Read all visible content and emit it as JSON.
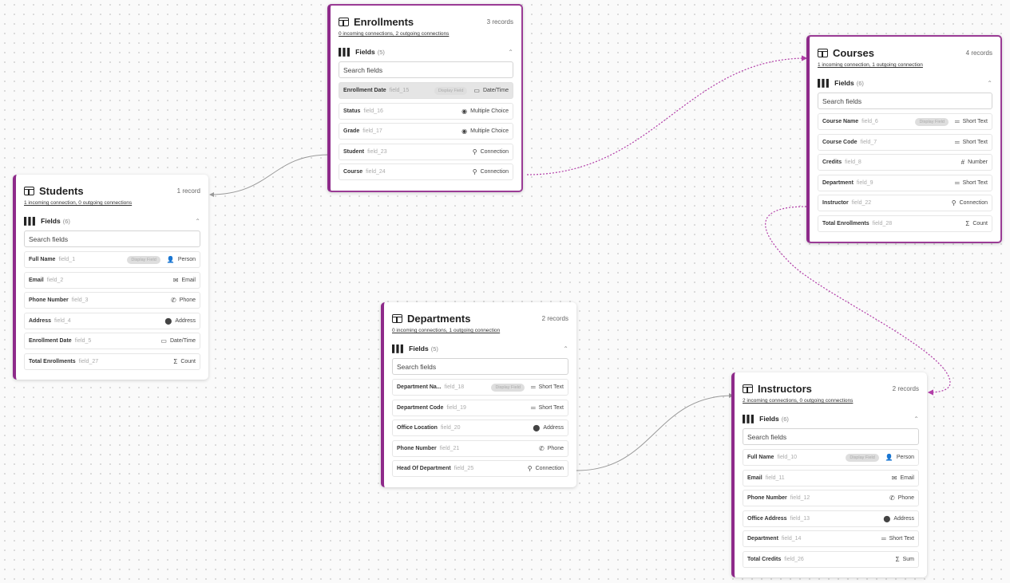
{
  "canvas": {
    "edge_color": "#999999",
    "highlight_edge_color": "#b23ea8",
    "accent": "#8e2a8a"
  },
  "tables": {
    "enrollments": {
      "title": "Enrollments",
      "records": "3 records",
      "connections": "0 incoming connections, 2 outgoing connections",
      "fields_label": "Fields",
      "fields_count": "(5)",
      "search_placeholder": "Search fields",
      "fields": [
        {
          "name": "Enrollment Date",
          "id": "field_15",
          "display": "Display Field",
          "type": "Date/Time",
          "icon": "calendar-icon"
        },
        {
          "name": "Status",
          "id": "field_16",
          "type": "Multiple Choice",
          "icon": "choice-icon"
        },
        {
          "name": "Grade",
          "id": "field_17",
          "type": "Multiple Choice",
          "icon": "choice-icon"
        },
        {
          "name": "Student",
          "id": "field_23",
          "type": "Connection",
          "icon": "connection-icon"
        },
        {
          "name": "Course",
          "id": "field_24",
          "type": "Connection",
          "icon": "connection-icon"
        }
      ]
    },
    "courses": {
      "title": "Courses",
      "records": "4 records",
      "connections": "1 incoming connection, 1 outgoing connection",
      "fields_label": "Fields",
      "fields_count": "(6)",
      "search_placeholder": "Search fields",
      "fields": [
        {
          "name": "Course Name",
          "id": "field_6",
          "display": "Display Field",
          "type": "Short Text",
          "icon": "text-icon"
        },
        {
          "name": "Course Code",
          "id": "field_7",
          "type": "Short Text",
          "icon": "text-icon"
        },
        {
          "name": "Credits",
          "id": "field_8",
          "type": "Number",
          "icon": "number-icon"
        },
        {
          "name": "Department",
          "id": "field_9",
          "type": "Short Text",
          "icon": "text-icon"
        },
        {
          "name": "Instructor",
          "id": "field_22",
          "type": "Connection",
          "icon": "connection-icon"
        },
        {
          "name": "Total Enrollments",
          "id": "field_28",
          "type": "Count",
          "icon": "sigma-icon"
        }
      ]
    },
    "students": {
      "title": "Students",
      "records": "1 record",
      "connections": "1 incoming connection, 0 outgoing connections",
      "fields_label": "Fields",
      "fields_count": "(6)",
      "search_placeholder": "Search fields",
      "fields": [
        {
          "name": "Full Name",
          "id": "field_1",
          "display": "Display Field",
          "type": "Person",
          "icon": "person-icon"
        },
        {
          "name": "Email",
          "id": "field_2",
          "type": "Email",
          "icon": "email-icon"
        },
        {
          "name": "Phone Number",
          "id": "field_3",
          "type": "Phone",
          "icon": "phone-icon"
        },
        {
          "name": "Address",
          "id": "field_4",
          "type": "Address",
          "icon": "pin-icon"
        },
        {
          "name": "Enrollment Date",
          "id": "field_5",
          "type": "Date/Time",
          "icon": "calendar-icon"
        },
        {
          "name": "Total Enrollments",
          "id": "field_27",
          "type": "Count",
          "icon": "sigma-icon"
        }
      ]
    },
    "departments": {
      "title": "Departments",
      "records": "2 records",
      "connections": "0 incoming connections, 1 outgoing connection",
      "fields_label": "Fields",
      "fields_count": "(5)",
      "search_placeholder": "Search fields",
      "fields": [
        {
          "name": "Department Na...",
          "id": "field_18",
          "display": "Display Field",
          "type": "Short Text",
          "icon": "text-icon"
        },
        {
          "name": "Department Code",
          "id": "field_19",
          "type": "Short Text",
          "icon": "text-icon"
        },
        {
          "name": "Office Location",
          "id": "field_20",
          "type": "Address",
          "icon": "pin-icon"
        },
        {
          "name": "Phone Number",
          "id": "field_21",
          "type": "Phone",
          "icon": "phone-icon"
        },
        {
          "name": "Head Of Department",
          "id": "field_25",
          "type": "Connection",
          "icon": "connection-icon"
        }
      ]
    },
    "instructors": {
      "title": "Instructors",
      "records": "2 records",
      "connections": "2 incoming connections, 0 outgoing connections",
      "fields_label": "Fields",
      "fields_count": "(6)",
      "search_placeholder": "Search fields",
      "fields": [
        {
          "name": "Full Name",
          "id": "field_10",
          "display": "Display Field",
          "type": "Person",
          "icon": "person-icon"
        },
        {
          "name": "Email",
          "id": "field_11",
          "type": "Email",
          "icon": "email-icon"
        },
        {
          "name": "Phone Number",
          "id": "field_12",
          "type": "Phone",
          "icon": "phone-icon"
        },
        {
          "name": "Office Address",
          "id": "field_13",
          "type": "Address",
          "icon": "pin-icon"
        },
        {
          "name": "Department",
          "id": "field_14",
          "type": "Short Text",
          "icon": "text-icon"
        },
        {
          "name": "Total Credits",
          "id": "field_26",
          "type": "Sum",
          "icon": "sigma-icon"
        }
      ]
    }
  }
}
